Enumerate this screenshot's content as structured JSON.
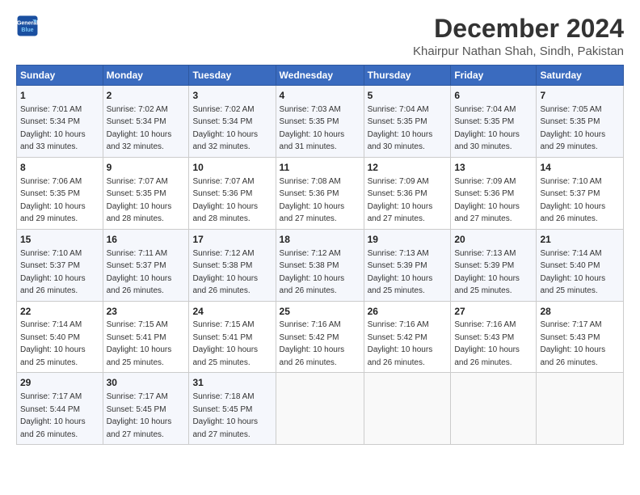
{
  "logo": {
    "line1": "General",
    "line2": "Blue"
  },
  "title": "December 2024",
  "subtitle": "Khairpur Nathan Shah, Sindh, Pakistan",
  "weekdays": [
    "Sunday",
    "Monday",
    "Tuesday",
    "Wednesday",
    "Thursday",
    "Friday",
    "Saturday"
  ],
  "weeks": [
    [
      {
        "day": 1,
        "sunrise": "7:01 AM",
        "sunset": "5:34 PM",
        "daylight": "10 hours and 33 minutes."
      },
      {
        "day": 2,
        "sunrise": "7:02 AM",
        "sunset": "5:34 PM",
        "daylight": "10 hours and 32 minutes."
      },
      {
        "day": 3,
        "sunrise": "7:02 AM",
        "sunset": "5:34 PM",
        "daylight": "10 hours and 32 minutes."
      },
      {
        "day": 4,
        "sunrise": "7:03 AM",
        "sunset": "5:35 PM",
        "daylight": "10 hours and 31 minutes."
      },
      {
        "day": 5,
        "sunrise": "7:04 AM",
        "sunset": "5:35 PM",
        "daylight": "10 hours and 30 minutes."
      },
      {
        "day": 6,
        "sunrise": "7:04 AM",
        "sunset": "5:35 PM",
        "daylight": "10 hours and 30 minutes."
      },
      {
        "day": 7,
        "sunrise": "7:05 AM",
        "sunset": "5:35 PM",
        "daylight": "10 hours and 29 minutes."
      }
    ],
    [
      {
        "day": 8,
        "sunrise": "7:06 AM",
        "sunset": "5:35 PM",
        "daylight": "10 hours and 29 minutes."
      },
      {
        "day": 9,
        "sunrise": "7:07 AM",
        "sunset": "5:35 PM",
        "daylight": "10 hours and 28 minutes."
      },
      {
        "day": 10,
        "sunrise": "7:07 AM",
        "sunset": "5:36 PM",
        "daylight": "10 hours and 28 minutes."
      },
      {
        "day": 11,
        "sunrise": "7:08 AM",
        "sunset": "5:36 PM",
        "daylight": "10 hours and 27 minutes."
      },
      {
        "day": 12,
        "sunrise": "7:09 AM",
        "sunset": "5:36 PM",
        "daylight": "10 hours and 27 minutes."
      },
      {
        "day": 13,
        "sunrise": "7:09 AM",
        "sunset": "5:36 PM",
        "daylight": "10 hours and 27 minutes."
      },
      {
        "day": 14,
        "sunrise": "7:10 AM",
        "sunset": "5:37 PM",
        "daylight": "10 hours and 26 minutes."
      }
    ],
    [
      {
        "day": 15,
        "sunrise": "7:10 AM",
        "sunset": "5:37 PM",
        "daylight": "10 hours and 26 minutes."
      },
      {
        "day": 16,
        "sunrise": "7:11 AM",
        "sunset": "5:37 PM",
        "daylight": "10 hours and 26 minutes."
      },
      {
        "day": 17,
        "sunrise": "7:12 AM",
        "sunset": "5:38 PM",
        "daylight": "10 hours and 26 minutes."
      },
      {
        "day": 18,
        "sunrise": "7:12 AM",
        "sunset": "5:38 PM",
        "daylight": "10 hours and 26 minutes."
      },
      {
        "day": 19,
        "sunrise": "7:13 AM",
        "sunset": "5:39 PM",
        "daylight": "10 hours and 25 minutes."
      },
      {
        "day": 20,
        "sunrise": "7:13 AM",
        "sunset": "5:39 PM",
        "daylight": "10 hours and 25 minutes."
      },
      {
        "day": 21,
        "sunrise": "7:14 AM",
        "sunset": "5:40 PM",
        "daylight": "10 hours and 25 minutes."
      }
    ],
    [
      {
        "day": 22,
        "sunrise": "7:14 AM",
        "sunset": "5:40 PM",
        "daylight": "10 hours and 25 minutes."
      },
      {
        "day": 23,
        "sunrise": "7:15 AM",
        "sunset": "5:41 PM",
        "daylight": "10 hours and 25 minutes."
      },
      {
        "day": 24,
        "sunrise": "7:15 AM",
        "sunset": "5:41 PM",
        "daylight": "10 hours and 25 minutes."
      },
      {
        "day": 25,
        "sunrise": "7:16 AM",
        "sunset": "5:42 PM",
        "daylight": "10 hours and 26 minutes."
      },
      {
        "day": 26,
        "sunrise": "7:16 AM",
        "sunset": "5:42 PM",
        "daylight": "10 hours and 26 minutes."
      },
      {
        "day": 27,
        "sunrise": "7:16 AM",
        "sunset": "5:43 PM",
        "daylight": "10 hours and 26 minutes."
      },
      {
        "day": 28,
        "sunrise": "7:17 AM",
        "sunset": "5:43 PM",
        "daylight": "10 hours and 26 minutes."
      }
    ],
    [
      {
        "day": 29,
        "sunrise": "7:17 AM",
        "sunset": "5:44 PM",
        "daylight": "10 hours and 26 minutes."
      },
      {
        "day": 30,
        "sunrise": "7:17 AM",
        "sunset": "5:45 PM",
        "daylight": "10 hours and 27 minutes."
      },
      {
        "day": 31,
        "sunrise": "7:18 AM",
        "sunset": "5:45 PM",
        "daylight": "10 hours and 27 minutes."
      },
      null,
      null,
      null,
      null
    ]
  ]
}
